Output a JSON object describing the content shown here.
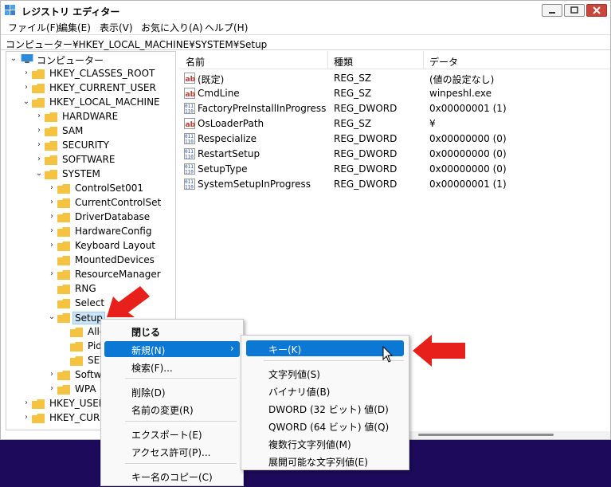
{
  "window": {
    "title": "レジストリ エディター",
    "menu": [
      "ファイル(F)",
      "編集(E)",
      "表示(V)",
      "お気に入り(A)",
      "ヘルプ(H)"
    ],
    "address": "コンピューター¥HKEY_LOCAL_MACHINE¥SYSTEM¥Setup"
  },
  "tree": {
    "root": "コンピューター",
    "hives": [
      "HKEY_CLASSES_ROOT",
      "HKEY_CURRENT_USER",
      "HKEY_LOCAL_MACHINE"
    ],
    "hklm": [
      "HARDWARE",
      "SAM",
      "SECURITY",
      "SOFTWARE",
      "SYSTEM"
    ],
    "system": [
      "ControlSet001",
      "CurrentControlSet",
      "DriverDatabase",
      "HardwareConfig",
      "Keyboard Layout",
      "MountedDevices",
      "ResourceManager",
      "RNG",
      "Select",
      "Setup"
    ],
    "setup_children": [
      "Allo",
      "Pid",
      "SET"
    ],
    "after_setup": [
      "Softwa",
      "WPA"
    ],
    "hives_bottom": [
      "HKEY_USERS",
      "HKEY_CURRI"
    ]
  },
  "list": {
    "headers": [
      "名前",
      "種類",
      "データ"
    ],
    "rows": [
      {
        "icon": "ab",
        "name": "(既定)",
        "type": "REG_SZ",
        "data": "(値の設定なし)"
      },
      {
        "icon": "ab",
        "name": "CmdLine",
        "type": "REG_SZ",
        "data": "winpeshl.exe"
      },
      {
        "icon": "bin",
        "name": "FactoryPreInstallInProgress",
        "type": "REG_DWORD",
        "data": "0x00000001 (1)"
      },
      {
        "icon": "ab",
        "name": "OsLoaderPath",
        "type": "REG_SZ",
        "data": "¥"
      },
      {
        "icon": "bin",
        "name": "Respecialize",
        "type": "REG_DWORD",
        "data": "0x00000000 (0)"
      },
      {
        "icon": "bin",
        "name": "RestartSetup",
        "type": "REG_DWORD",
        "data": "0x00000000 (0)"
      },
      {
        "icon": "bin",
        "name": "SetupType",
        "type": "REG_DWORD",
        "data": "0x00000000 (0)"
      },
      {
        "icon": "bin",
        "name": "SystemSetupInProgress",
        "type": "REG_DWORD",
        "data": "0x00000001 (1)"
      }
    ]
  },
  "context_menu": {
    "collapse": "閉じる",
    "new": "新規(N)",
    "find": "検索(F)...",
    "delete": "削除(D)",
    "rename": "名前の変更(R)",
    "export": "エクスポート(E)",
    "permissions": "アクセス許可(P)...",
    "copy_key_name": "キー名のコピー(C)"
  },
  "submenu": {
    "key": "キー(K)",
    "string": "文字列値(S)",
    "binary": "バイナリ値(B)",
    "dword": "DWORD (32 ビット) 値(D)",
    "qword": "QWORD (64 ビット) 値(Q)",
    "multi": "複数行文字列値(M)",
    "expand": "展開可能な文字列値(E)"
  },
  "colors": {
    "highlight": "#0a78d4",
    "folder": "#f5c342",
    "arrow": "#e8201c",
    "desktop": "#1e0a5a"
  }
}
